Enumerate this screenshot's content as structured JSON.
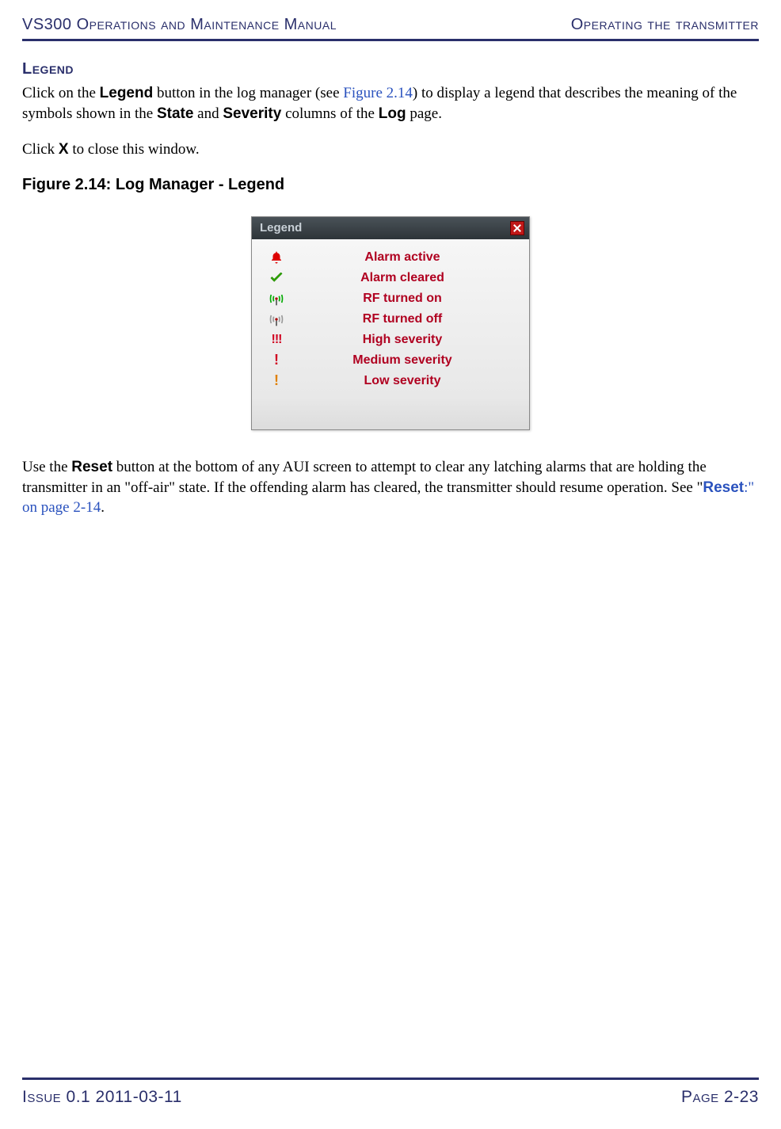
{
  "header": {
    "manual_title": "VS300 Operations and Maintenance Manual",
    "chapter_title": "Operating the transmitter"
  },
  "section": {
    "heading": "Legend",
    "para1_pre": "Click on the ",
    "para1_btn": "Legend",
    "para1_mid1": " button in the log manager (see ",
    "para1_link": "Figure 2.14",
    "para1_mid2": ") to display a legend that describes the meaning of the symbols shown in the ",
    "para1_state": "State",
    "para1_mid3": " and ",
    "para1_severity": "Severity",
    "para1_mid4": " columns of the ",
    "para1_log": "Log",
    "para1_end": " page.",
    "para2_pre": "Click ",
    "para2_x": "X",
    "para2_end": " to close this window."
  },
  "figure": {
    "caption": "Figure 2.14: Log Manager - Legend",
    "widget_title": "Legend",
    "items": {
      "alarm_active": "Alarm active",
      "alarm_cleared": "Alarm cleared",
      "rf_on": "RF turned on",
      "rf_off": "RF turned off",
      "high_sev": "High severity",
      "med_sev": "Medium severity",
      "low_sev": "Low severity"
    },
    "icons": {
      "high": "!!!",
      "med": "!",
      "low": "!"
    }
  },
  "reset_para": {
    "pre": "Use the ",
    "reset": "Reset",
    "mid": " button at the bottom of any AUI screen to attempt to clear any latching alarms that are holding the transmitter in an \"off-air\" state. If the offending alarm has cleared, the transmitter should resume operation. See \"",
    "link_reset": "Reset",
    "link_rest": ":\" on page 2-14",
    "end": "."
  },
  "footer": {
    "issue": "Issue 0.1  2011-03-11",
    "page": "Page 2-23"
  }
}
